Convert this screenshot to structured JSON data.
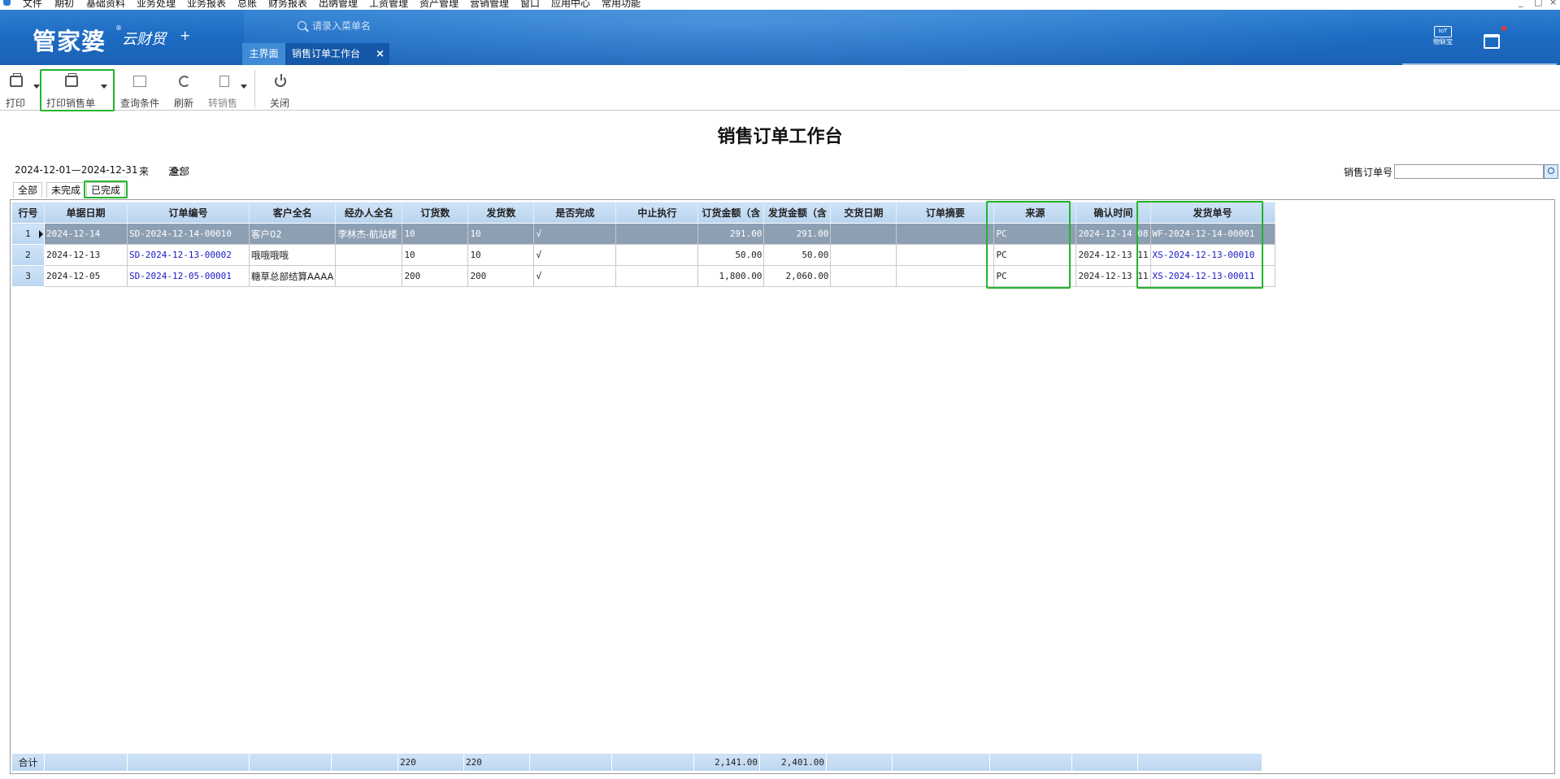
{
  "menubar": {
    "items": [
      "文件",
      "期初",
      "基础资料",
      "业务处理",
      "业务报表",
      "总账",
      "财务报表",
      "出纳管理",
      "工资管理",
      "资产管理",
      "营销管理",
      "窗口",
      "应用中心",
      "常用功能"
    ],
    "window_controls": [
      "_",
      "□",
      "×"
    ]
  },
  "header": {
    "logo_text": "管家婆",
    "logo_tm": "®",
    "logo_sub": "云财贸",
    "logo_plus": "+",
    "search_placeholder": "请录入菜单名",
    "tabs": {
      "home": "主界面",
      "active": "销售订单工作台"
    },
    "close_glyph": "×",
    "iot_label": "物联宝",
    "iot_box_text": "IoT",
    "icons": [
      "iot-box-icon",
      "calendar-icon"
    ]
  },
  "toolbar": {
    "print": "打印",
    "print_sales": "打印销售单",
    "query": "查询条件",
    "refresh": "刷新",
    "to_sales": "转销售",
    "close": "关闭"
  },
  "page": {
    "title": "销售订单工作台",
    "date_range": "2024-12-01—2024-12-31",
    "source_label": "来　　源：",
    "source_value": "全部",
    "order_no_label": "销售订单号",
    "order_no_value": ""
  },
  "subtabs": {
    "all": "全部",
    "incomplete": "未完成",
    "complete": "已完成"
  },
  "grid": {
    "columns": [
      "行号",
      "单据日期",
      "订单编号",
      "客户全名",
      "经办人全名",
      "订货数",
      "发货数",
      "是否完成",
      "中止执行",
      "订货金额（含",
      "发货金额（含",
      "交货日期",
      "订单摘要",
      "来源",
      "确认时间",
      "发货单号"
    ],
    "rows": [
      {
        "n": "1",
        "date": "2024-12-14",
        "order_no": "SD-2024-12-14-00010",
        "customer": "客户02",
        "handler": "李林杰-航站楼",
        "qty_order": "10",
        "qty_ship": "10",
        "done": "√",
        "stop": "",
        "amt_order": "291.00",
        "amt_ship": "291.00",
        "deliver": "",
        "summary": "",
        "source": "PC",
        "confirm": "2024-12-14 08",
        "ship_no": "WF-2024-12-14-00001"
      },
      {
        "n": "2",
        "date": "2024-12-13",
        "order_no": "SD-2024-12-13-00002",
        "customer": "哦哦哦哦",
        "handler": "",
        "qty_order": "10",
        "qty_ship": "10",
        "done": "√",
        "stop": "",
        "amt_order": "50.00",
        "amt_ship": "50.00",
        "deliver": "",
        "summary": "",
        "source": "PC",
        "confirm": "2024-12-13 11",
        "ship_no": "XS-2024-12-13-00010"
      },
      {
        "n": "3",
        "date": "2024-12-05",
        "order_no": "SD-2024-12-05-00001",
        "customer": "糖草总部结算AAAA",
        "handler": "",
        "qty_order": "200",
        "qty_ship": "200",
        "done": "√",
        "stop": "",
        "amt_order": "1,800.00",
        "amt_ship": "2,060.00",
        "deliver": "",
        "summary": "",
        "source": "PC",
        "confirm": "2024-12-13 11",
        "ship_no": "XS-2024-12-13-00011"
      }
    ],
    "totals": {
      "label": "合计",
      "qty_order": "220",
      "qty_ship": "220",
      "amt_order": "2,141.00",
      "amt_ship": "2,401.00"
    }
  },
  "colors": {
    "header_blue": "#1d6cc4",
    "highlight_green": "#21b52b",
    "link_blue": "#1818c8",
    "link_yellow": "#ffff00",
    "selected_row": "#8d9fb3"
  }
}
